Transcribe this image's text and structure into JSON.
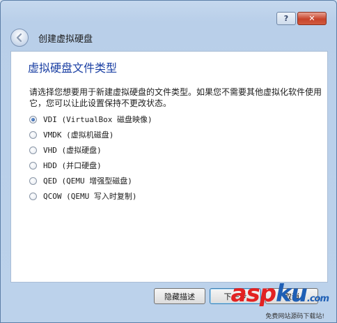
{
  "window": {
    "help_label": "?",
    "close_label": "✕"
  },
  "header": {
    "title": "创建虚拟硬盘",
    "back_icon": "back-arrow-icon"
  },
  "page": {
    "title": "虚拟硬盘文件类型",
    "description": "请选择您想要用于新建虚拟硬盘的文件类型。如果您不需要其他虚拟化软件使用它，您可以让此设置保持不更改状态。"
  },
  "options": [
    {
      "label": "VDI (VirtualBox 磁盘映像)",
      "checked": true
    },
    {
      "label": "VMDK (虚拟机磁盘)",
      "checked": false
    },
    {
      "label": "VHD (虚拟硬盘)",
      "checked": false
    },
    {
      "label": "HDD (并口硬盘)",
      "checked": false
    },
    {
      "label": "QED (QEMU 增强型磁盘)",
      "checked": false
    },
    {
      "label": "QCOW (QEMU 写入时复制)",
      "checked": false
    }
  ],
  "footer": {
    "hide_label": "隐藏描述",
    "next_label": "下一步",
    "cancel_label": "取消"
  },
  "watermark": {
    "a": "asp",
    "b": "ku",
    "suffix": ".com",
    "sub": "免费网站源码下载站!"
  }
}
